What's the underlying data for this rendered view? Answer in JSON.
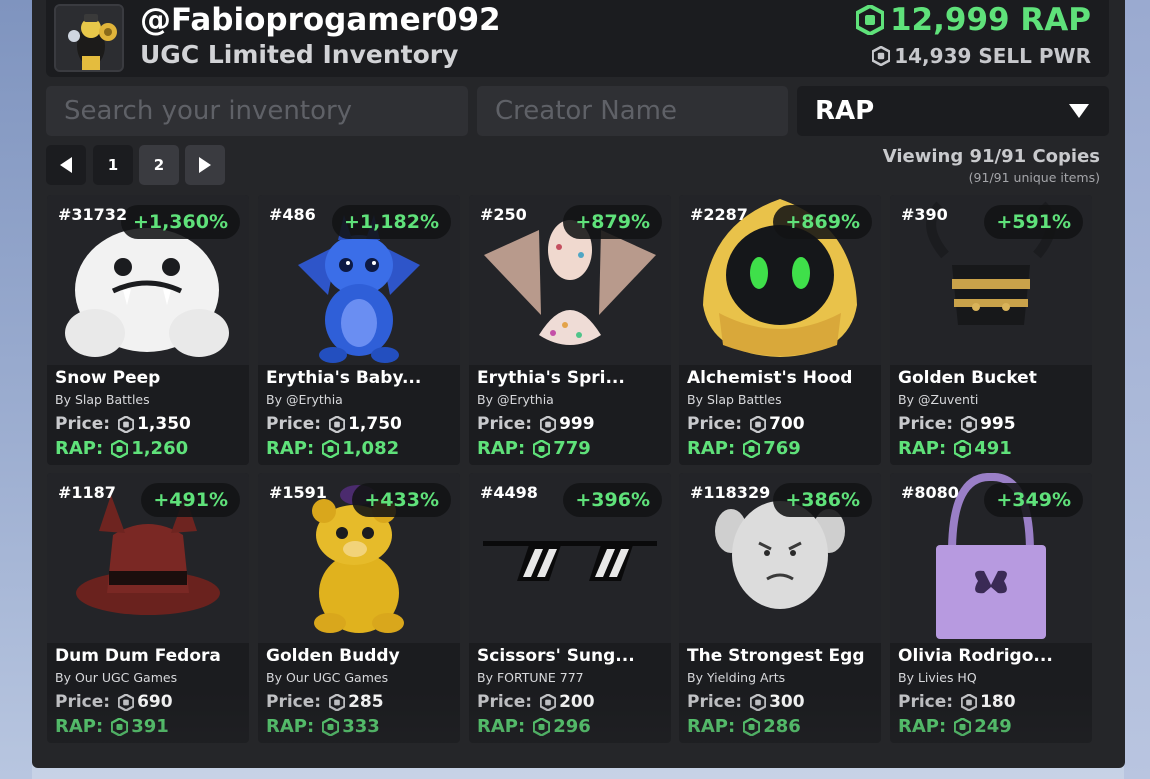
{
  "header": {
    "username": "@Fabioprogamer092",
    "subtitle": "UGC Limited Inventory",
    "rap_total": "12,999 RAP",
    "sell_power": "14,939 SELL PWR"
  },
  "filters": {
    "search_placeholder": "Search your inventory",
    "creator_placeholder": "Creator Name",
    "sort_value": "RAP"
  },
  "pagination": {
    "pages": [
      "1",
      "2"
    ],
    "current_page": "2"
  },
  "summary": {
    "viewing": "Viewing 91/91 Copies",
    "unique": "(91/91 unique items)"
  },
  "labels": {
    "price": "Price:",
    "rap": "RAP:"
  },
  "colors": {
    "accent_green": "#5fe17a",
    "panel": "#252629",
    "card": "#1b1c1f"
  },
  "items": [
    {
      "serial": "#31732",
      "pct": "+1,360%",
      "name": "Snow Peep",
      "creator": "By Slap Battles",
      "price": "1,350",
      "rap": "1,260",
      "icon": "snow-peep-icon"
    },
    {
      "serial": "#486",
      "pct": "+1,182%",
      "name": "Erythia's Baby...",
      "creator": "By @Erythia",
      "price": "1,750",
      "rap": "1,082",
      "icon": "blue-dragon-icon"
    },
    {
      "serial": "#250",
      "pct": "+879%",
      "name": "Erythia's Spri...",
      "creator": "By @Erythia",
      "price": "999",
      "rap": "779",
      "icon": "sprinkle-dragon-icon"
    },
    {
      "serial": "#2287",
      "pct": "+869%",
      "name": "Alchemist's Hood",
      "creator": "By Slap Battles",
      "price": "700",
      "rap": "769",
      "icon": "golden-hood-icon"
    },
    {
      "serial": "#390",
      "pct": "+591%",
      "name": "Golden Bucket",
      "creator": "By @Zuventi",
      "price": "995",
      "rap": "491",
      "icon": "golden-bucket-icon"
    },
    {
      "serial": "#1187",
      "pct": "+491%",
      "name": "Dum Dum Fedora",
      "creator": "By Our UGC Games",
      "price": "690",
      "rap": "391",
      "icon": "fedora-icon"
    },
    {
      "serial": "#1591",
      "pct": "+433%",
      "name": "Golden Buddy",
      "creator": "By Our UGC Games",
      "price": "285",
      "rap": "333",
      "icon": "golden-bear-icon"
    },
    {
      "serial": "#4498",
      "pct": "+396%",
      "name": "Scissors' Sung...",
      "creator": "By FORTUNE 777",
      "price": "200",
      "rap": "296",
      "icon": "sunglasses-icon"
    },
    {
      "serial": "#118329",
      "pct": "+386%",
      "name": "The Strongest Egg",
      "creator": "By Yielding Arts",
      "price": "300",
      "rap": "286",
      "icon": "muscle-egg-icon"
    },
    {
      "serial": "#8080",
      "pct": "+349%",
      "name": "Olivia Rodrigo...",
      "creator": "By Livies HQ",
      "price": "180",
      "rap": "249",
      "icon": "tote-bag-icon"
    }
  ]
}
